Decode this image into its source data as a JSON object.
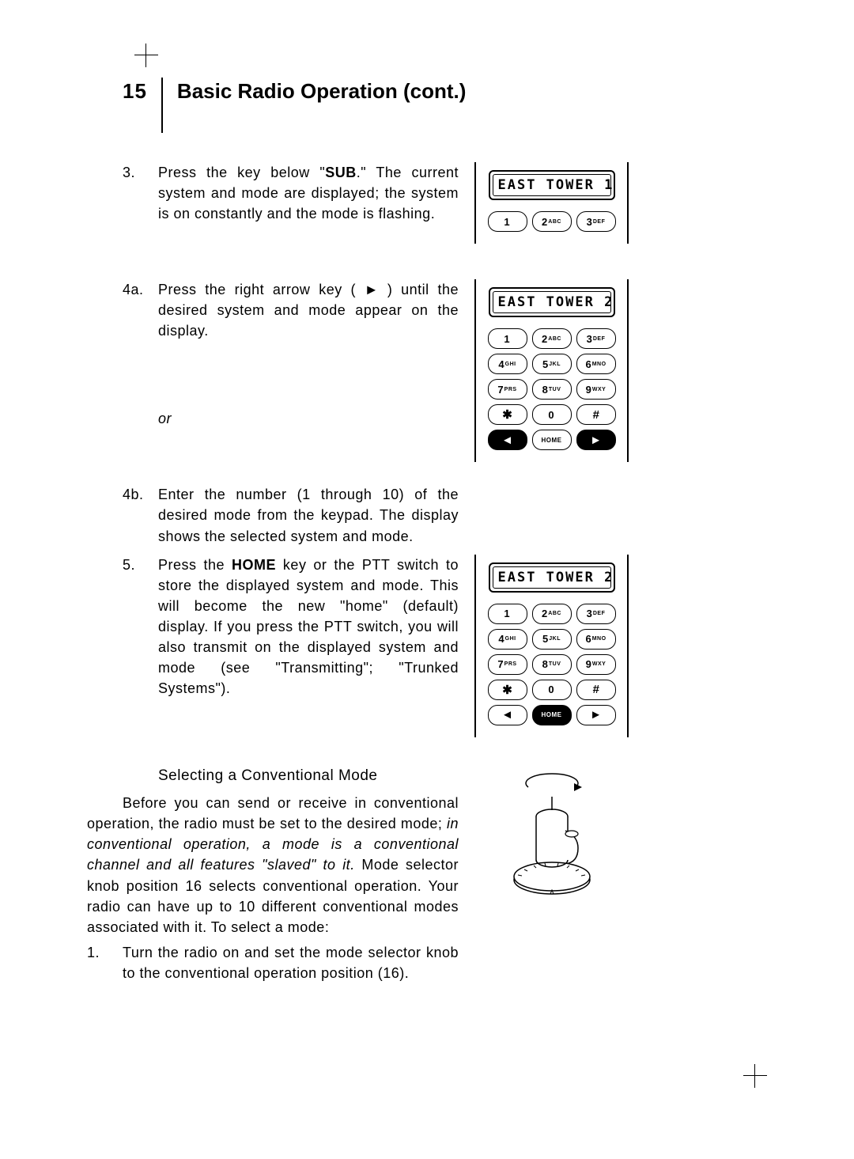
{
  "page_number": "15",
  "title": "Basic Radio Operation (cont.)",
  "steps": {
    "s3": {
      "idx": "3.",
      "body_html": "Press the key below \"<b>SUB</b>.\" The current system and mode are displayed; the system is on constantly and the mode is flashing."
    },
    "s4a": {
      "idx": "4a.",
      "body": "Press the right arrow key ( ► ) until the desired system and mode appear on the display."
    },
    "or": "or",
    "s4b": {
      "idx": "4b.",
      "body": "Enter the number (1 through 10) of the desired mode from the keypad. The display shows the selected system and mode."
    },
    "s5": {
      "idx": "5.",
      "body_html": "Press the <b>HOME</b> key or the PTT switch to store the displayed system and mode. This will become the new \"home\" (default) display. If you press the PTT switch, you will also transmit on the displayed system and mode (see \"Transmitting\"; \"Trunked Systems\")."
    }
  },
  "section2": {
    "heading": "Selecting a Conventional Mode",
    "p1_html": "Before you can send or receive in conventional operation, the radio must be set to the desired mode; <i>in conventional operation, a mode is a conventional channel and all features \"slaved\" to it.</i> Mode selector knob position 16 selects conventional operation. Your radio can have up to 10 different conventional modes associated with it. To select a mode:",
    "step1": {
      "idx": "1.",
      "body": "Turn the radio on and set the mode selector knob to the conventional operation position (16)."
    }
  },
  "displays": {
    "d1": "EAST TOWER 1",
    "d2": "EAST TOWER 2",
    "d3": "EAST TOWER 2"
  },
  "keys": {
    "k1": "1",
    "k2": {
      "n": "2",
      "l": "ABC"
    },
    "k3": {
      "n": "3",
      "l": "DEF"
    },
    "k4": {
      "n": "4",
      "l": "GHI"
    },
    "k5": {
      "n": "5",
      "l": "JKL"
    },
    "k6": {
      "n": "6",
      "l": "MNO"
    },
    "k7": {
      "n": "7",
      "l": "PRS"
    },
    "k8": {
      "n": "8",
      "l": "TUV"
    },
    "k9": {
      "n": "9",
      "l": "WXY"
    },
    "k0": "0",
    "star": "✱",
    "hash": "#",
    "left": "◄",
    "home": "HOME",
    "right": "►"
  }
}
